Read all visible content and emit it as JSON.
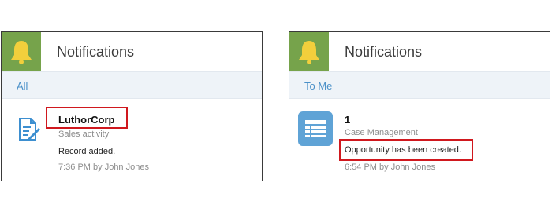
{
  "panels": [
    {
      "header_title": "Notifications",
      "filter_label": "All",
      "item": {
        "name": "LuthorCorp",
        "subtitle": "Sales activity",
        "message": "Record added.",
        "meta": "7:36 PM  by John Jones"
      },
      "icon": "document-edit-icon"
    },
    {
      "header_title": "Notifications",
      "filter_label": "To Me",
      "item": {
        "name": "1",
        "subtitle": "Case Management",
        "message": "Opportunity has been created.",
        "meta": "6:54 PM  by John Jones"
      },
      "icon": "list-app-icon"
    }
  ],
  "colors": {
    "bell_bg": "#76a34b",
    "filter_bar_bg": "#eef3f8",
    "filter_text": "#4a90c8",
    "highlight_border": "#d0181e",
    "app_icon_bg": "#5fa3d6"
  },
  "icons": {
    "header": "bell-icon"
  }
}
